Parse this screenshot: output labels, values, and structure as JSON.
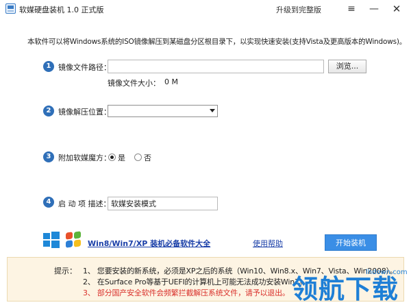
{
  "window": {
    "title": "软媒硬盘装机 1.0 正式版",
    "upgrade_link": "升级到完整版",
    "menu_glyph": "≡",
    "minimize_glyph": "—",
    "close_glyph": "✕"
  },
  "intro": "本软件可以将Windows系统的ISO镜像解压到某磁盘分区根目录下，以实现快速安装(支持Vista及更高版本的Windows)。",
  "steps": [
    {
      "num": "1",
      "label": "镜像文件路径：",
      "value": "",
      "browse_label": "浏览...",
      "size_label": "镜像文件大小：",
      "size_value": "0 M"
    },
    {
      "num": "2",
      "label": "镜像解压位置：",
      "selected": ""
    },
    {
      "num": "3",
      "label": "附加软媒魔方：",
      "options": [
        {
          "label": "是",
          "checked": true
        },
        {
          "label": "否",
          "checked": false
        }
      ]
    },
    {
      "num": "4",
      "label": "启 动 项 描述：",
      "value": "软媒安装模式"
    }
  ],
  "footer": {
    "win_link": "Win8/Win7/XP 装机必备软件大全",
    "help_link": "使用帮助",
    "start_button": "开始装机"
  },
  "tips": {
    "label": "提示：",
    "items": [
      {
        "text": "1、 您要安装的新系统，必须是XP之后的系统（Win10、Win8.x、Win7、Vista、Win2008）。",
        "color": "#222222"
      },
      {
        "text": "2、 在Surface Pro等基于UEFI的计算机上可能无法成功安装Win7。",
        "color": "#222222"
      },
      {
        "text": "3、 部分国产安全软件会频繁拦截解压系统文件，请予以退出。",
        "color": "#d9302b"
      }
    ]
  },
  "watermark": {
    "big": "领航下载",
    "small": "lhdown.com"
  },
  "colors": {
    "accent": "#2f6fb8",
    "start_button": "#3a8ee6",
    "link": "#1a3fa8",
    "warning": "#d9302b",
    "tips_bg": "#fdf4e3"
  },
  "icons": [
    "app-icon",
    "menu-icon",
    "minimize-icon",
    "close-icon",
    "windows8-logo-icon",
    "windows-xp-logo-icon",
    "dropdown-arrow-icon"
  ]
}
